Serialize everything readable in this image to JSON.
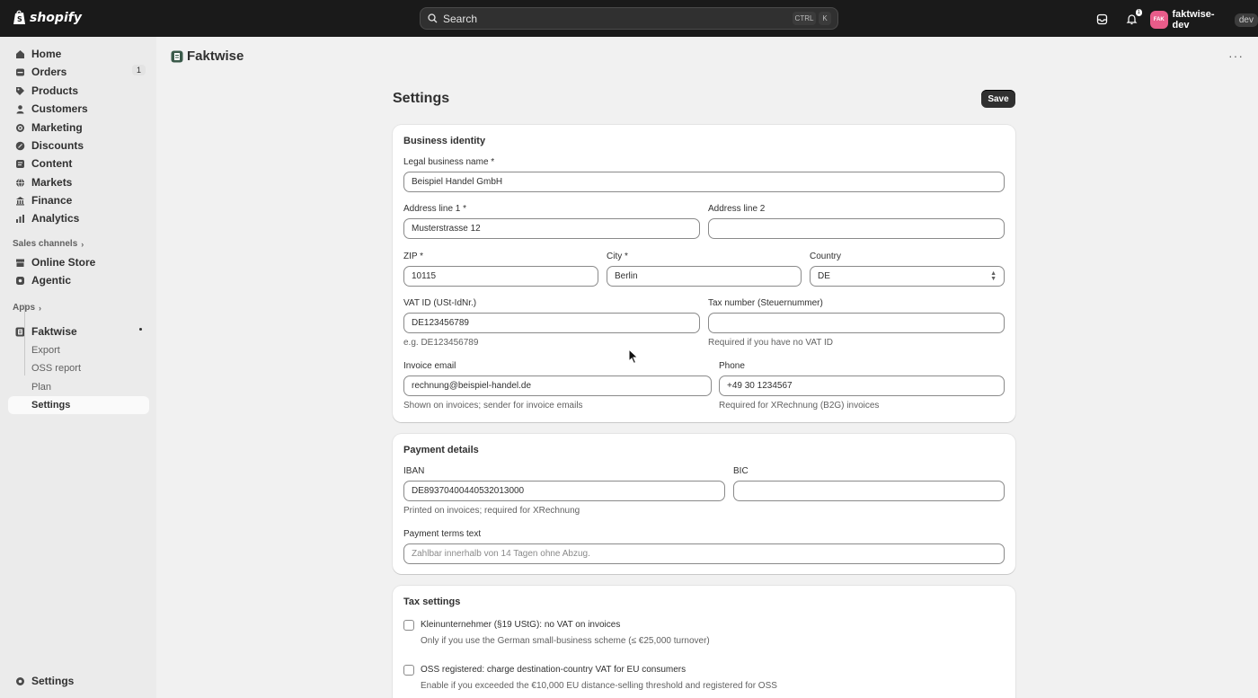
{
  "topbar": {
    "logo_text": "shopify",
    "search_placeholder": "Search",
    "kbd_ctrl": "CTRL",
    "kbd_k": "K",
    "notification_count": "1",
    "store_initials": "FAK",
    "store_name": "faktwise-dev",
    "store_badge": "dev"
  },
  "sidebar": {
    "items": [
      {
        "label": "Home",
        "icon": "home-icon"
      },
      {
        "label": "Orders",
        "icon": "orders-icon",
        "count": "1"
      },
      {
        "label": "Products",
        "icon": "tag-icon"
      },
      {
        "label": "Customers",
        "icon": "person-icon"
      },
      {
        "label": "Marketing",
        "icon": "target-icon"
      },
      {
        "label": "Discounts",
        "icon": "discount-icon"
      },
      {
        "label": "Content",
        "icon": "content-icon"
      },
      {
        "label": "Markets",
        "icon": "globe-icon"
      },
      {
        "label": "Finance",
        "icon": "bank-icon"
      },
      {
        "label": "Analytics",
        "icon": "chart-icon"
      }
    ],
    "sales_channels_label": "Sales channels",
    "channels": [
      {
        "label": "Online Store",
        "icon": "store-icon"
      },
      {
        "label": "Agentic",
        "icon": "agentic-icon"
      }
    ],
    "apps_label": "Apps",
    "app": {
      "label": "Faktwise",
      "icon": "faktwise-icon"
    },
    "app_subitems": [
      "Export",
      "OSS report",
      "Plan",
      "Settings"
    ],
    "bottom_settings": "Settings"
  },
  "app_header": {
    "title": "Faktwise"
  },
  "page": {
    "title": "Settings",
    "save_label": "Save"
  },
  "business_identity": {
    "title": "Business identity",
    "legal_name_label": "Legal business name *",
    "legal_name_value": "Beispiel Handel GmbH",
    "address1_label": "Address line 1 *",
    "address1_value": "Musterstrasse 12",
    "address2_label": "Address line 2",
    "address2_value": "",
    "zip_label": "ZIP *",
    "zip_value": "10115",
    "city_label": "City *",
    "city_value": "Berlin",
    "country_label": "Country",
    "country_value": "DE",
    "vat_label": "VAT ID (USt-IdNr.)",
    "vat_value": "DE123456789",
    "vat_help": "e.g. DE123456789",
    "tax_label": "Tax number (Steuernummer)",
    "tax_value": "",
    "tax_help": "Required if you have no VAT ID",
    "email_label": "Invoice email",
    "email_value": "rechnung@beispiel-handel.de",
    "email_help": "Shown on invoices; sender for invoice emails",
    "phone_label": "Phone",
    "phone_value": "+49 30 1234567",
    "phone_help": "Required for XRechnung (B2G) invoices"
  },
  "payment_details": {
    "title": "Payment details",
    "iban_label": "IBAN",
    "iban_value": "DE89370400440532013000",
    "iban_help": "Printed on invoices; required for XRechnung",
    "bic_label": "BIC",
    "bic_value": "",
    "terms_label": "Payment terms text",
    "terms_placeholder": "Zahlbar innerhalb von 14 Tagen ohne Abzug."
  },
  "tax_settings": {
    "title": "Tax settings",
    "klein_label": "Kleinunternehmer (§19 UStG): no VAT on invoices",
    "klein_help": "Only if you use the German small-business scheme (≤ €25,000 turnover)",
    "oss_label": "OSS registered: charge destination-country VAT for EU consumers",
    "oss_help": "Enable if you exceeded the €10,000 EU distance-selling threshold and registered for OSS"
  }
}
